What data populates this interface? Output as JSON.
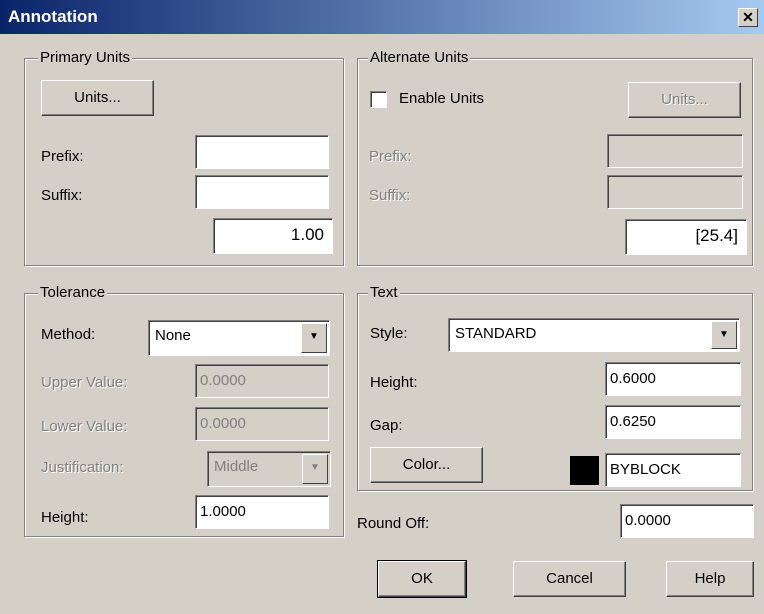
{
  "window": {
    "title": "Annotation",
    "close_glyph": "✕"
  },
  "primary": {
    "legend": "Primary Units",
    "units_button": "Units...",
    "prefix_label": "Prefix:",
    "suffix_label": "Suffix:",
    "prefix_value": "",
    "suffix_value": "",
    "sample": "1.00"
  },
  "alternate": {
    "legend": "Alternate Units",
    "enable_label": "Enable Units",
    "enable_checked": false,
    "units_button": "Units...",
    "prefix_label": "Prefix:",
    "suffix_label": "Suffix:",
    "sample": "[25.4]"
  },
  "tolerance": {
    "legend": "Tolerance",
    "method_label": "Method:",
    "method_value": "None",
    "upper_label": "Upper Value:",
    "upper_value": "0.0000",
    "lower_label": "Lower Value:",
    "lower_value": "0.0000",
    "justification_label": "Justification:",
    "justification_value": "Middle",
    "height_label": "Height:",
    "height_value": "1.0000"
  },
  "text": {
    "legend": "Text",
    "style_label": "Style:",
    "style_value": "STANDARD",
    "height_label": "Height:",
    "height_value": "0.6000",
    "gap_label": "Gap:",
    "gap_value": "0.6250",
    "color_button": "Color...",
    "color_value": "BYBLOCK",
    "color_swatch": "#000000"
  },
  "roundoff": {
    "label": "Round Off:",
    "value": "0.0000"
  },
  "buttons": {
    "ok": "OK",
    "cancel": "Cancel",
    "help": "Help"
  }
}
